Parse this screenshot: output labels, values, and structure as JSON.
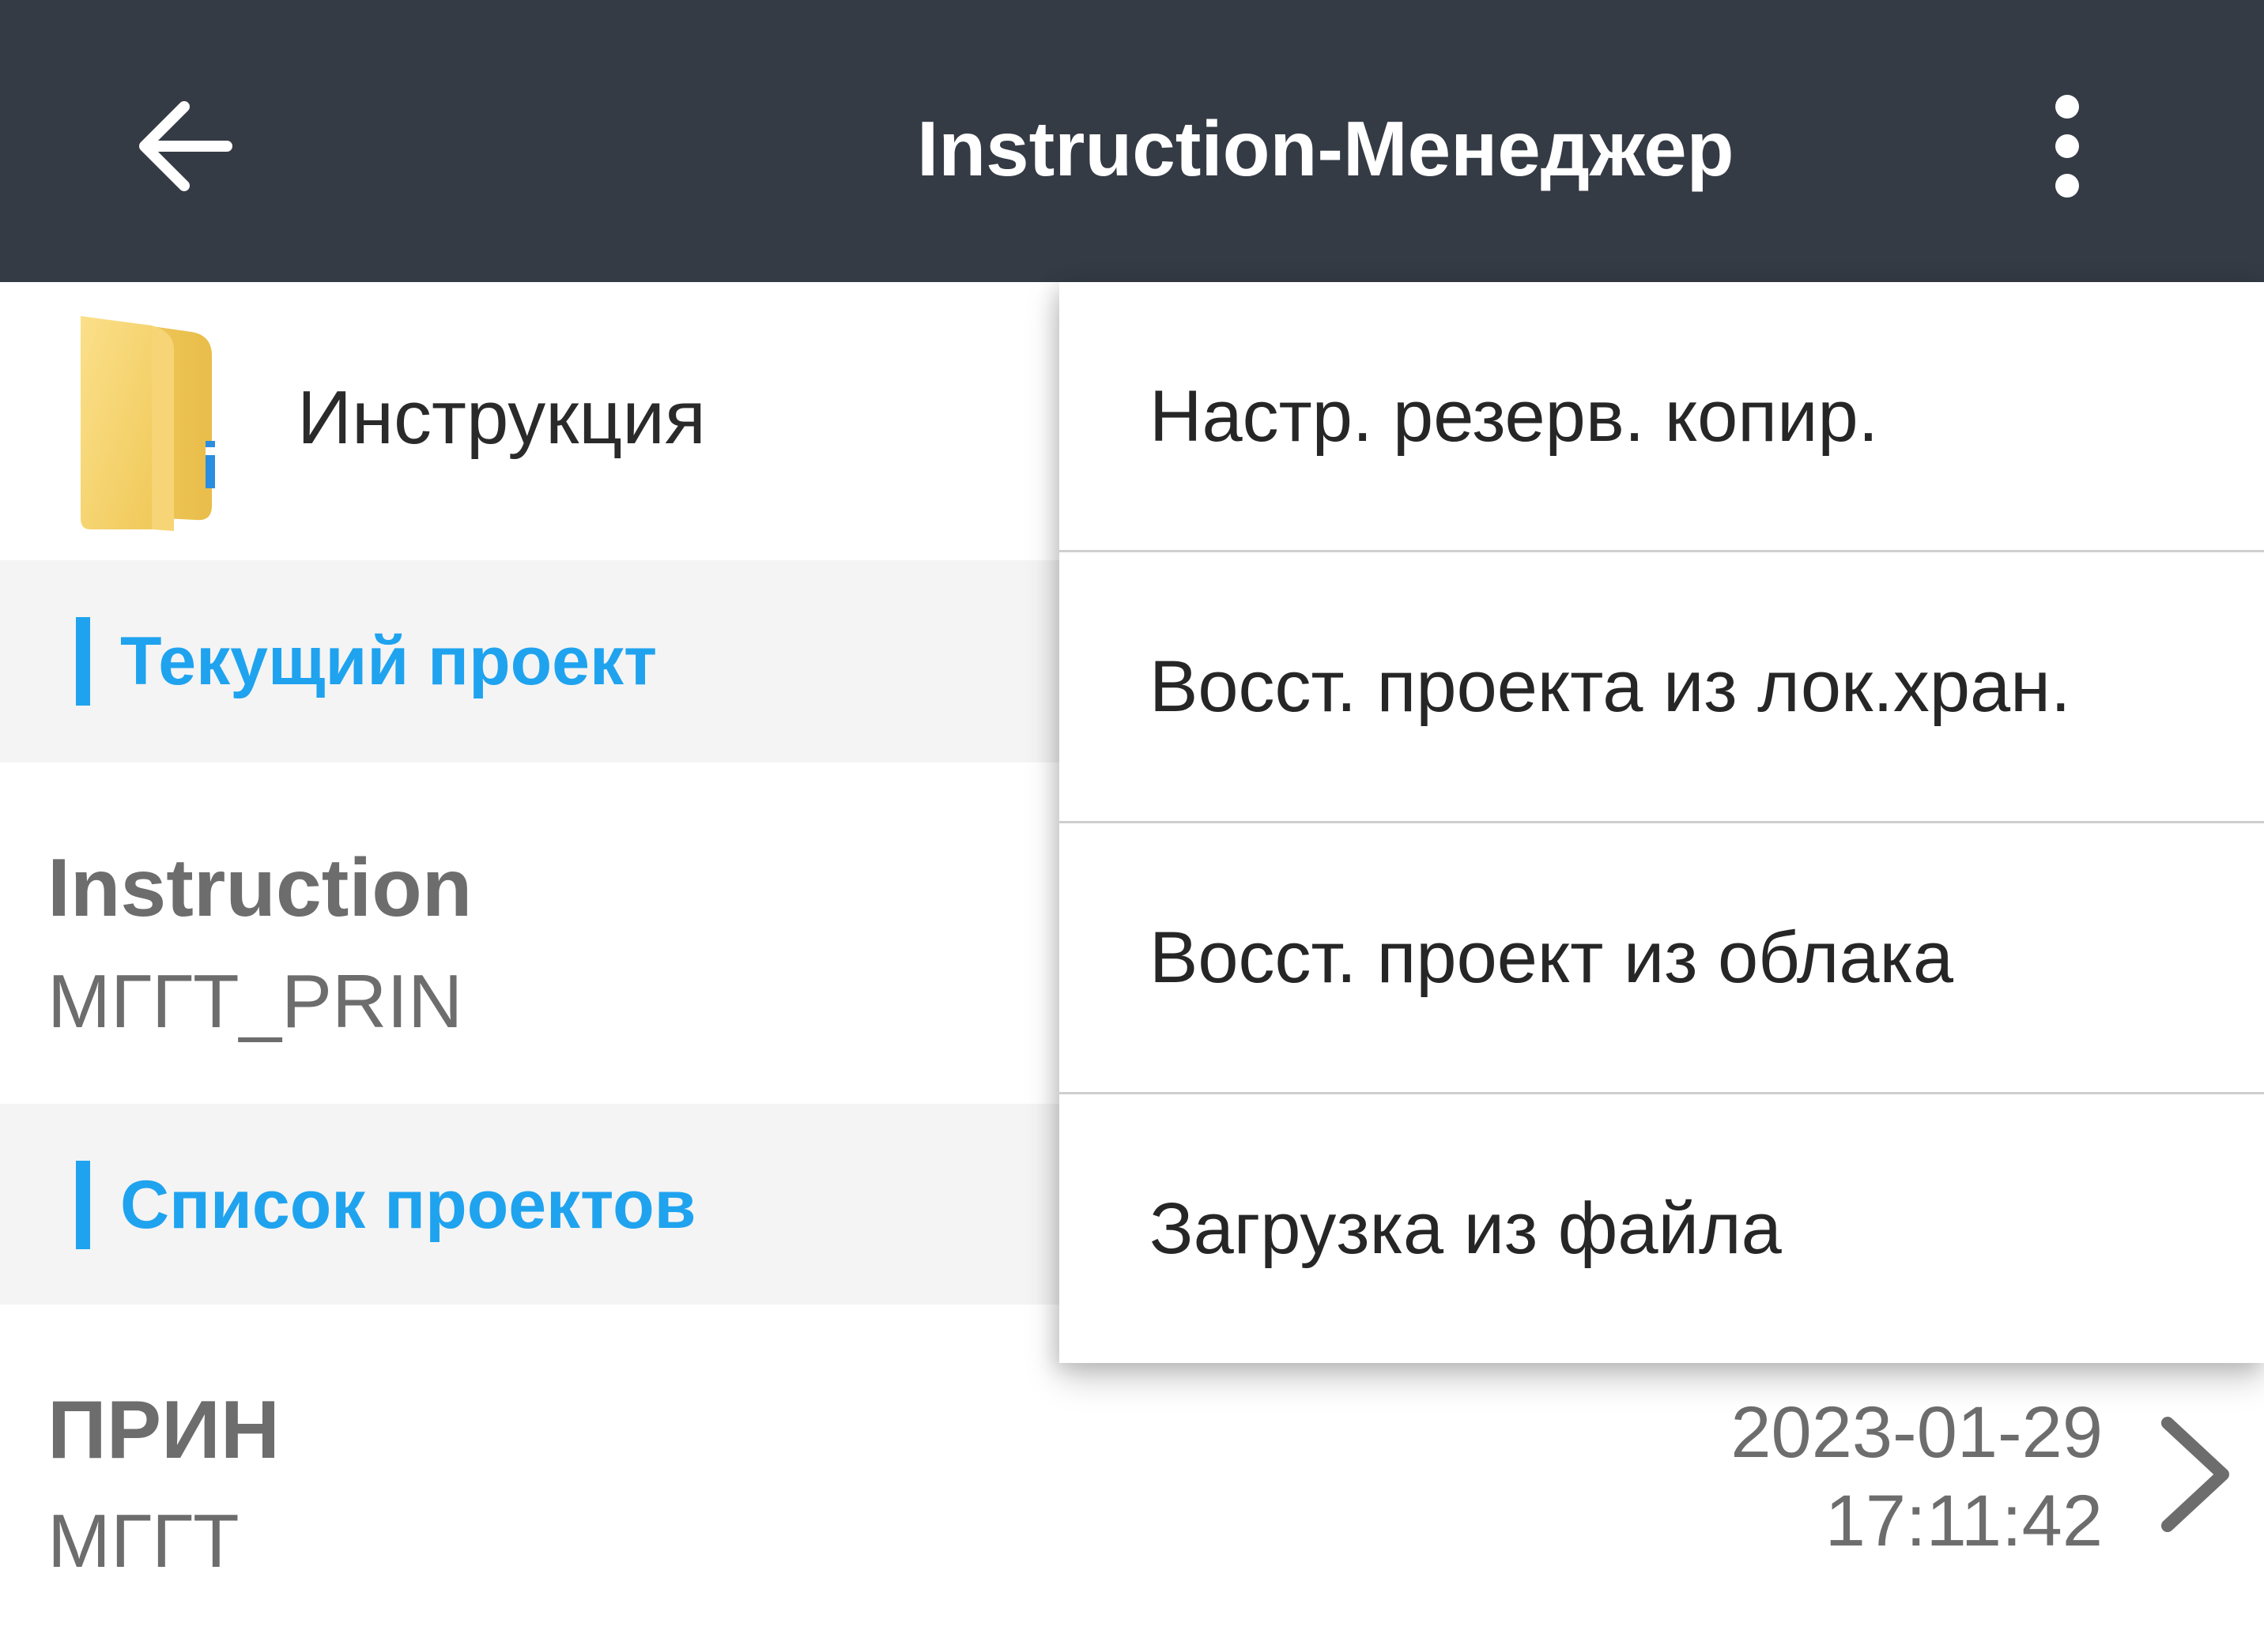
{
  "appbar": {
    "title": "Instruction-Менеджер",
    "background": "#353b45",
    "back_icon": "arrow-left-icon",
    "more_icon": "more-vertical-icon"
  },
  "folder": {
    "icon": "folder-icon",
    "label": "Инструкция"
  },
  "sections": {
    "current": "Текущий проект",
    "list": "Список проектов",
    "accent": "#1fa3ef"
  },
  "current_project": {
    "name": "Instruction",
    "code": "МГГТ_PRIN"
  },
  "projects": [
    {
      "name": "ПРИН",
      "code": "МГГТ",
      "date": "2023-01-29",
      "time": "17:11:42",
      "icon": "chevron-right-icon"
    }
  ],
  "menu": {
    "items": [
      {
        "label": "Настр. резерв. копир."
      },
      {
        "label": "Восст. проекта из лок.хран."
      },
      {
        "label": "Восст. проект из облака"
      },
      {
        "label": "Загрузка из файла"
      }
    ]
  }
}
